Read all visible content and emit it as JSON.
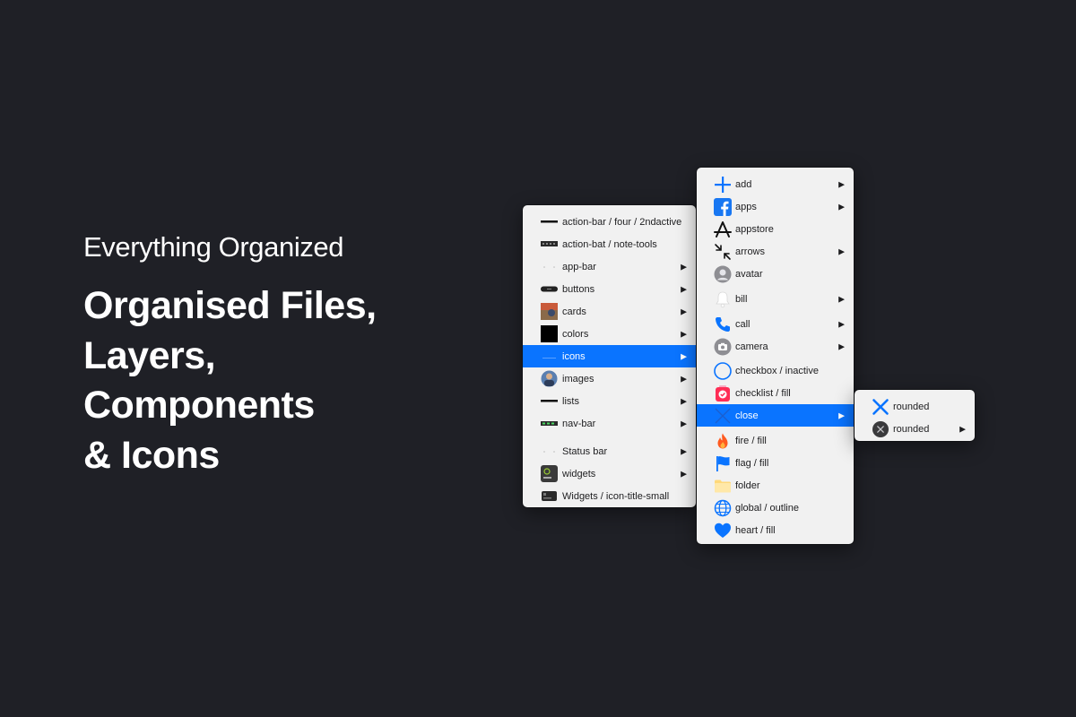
{
  "hero": {
    "eyebrow": "Everything Organized",
    "headline": [
      "Organised Files,",
      "Layers,",
      "Components",
      "& Icons"
    ]
  },
  "colors": {
    "background": "#1f2026",
    "menu_bg": "#f1f1f1",
    "selection": "#0a74ff",
    "icon_blue": "#0a74ff"
  },
  "menu_layers": {
    "items": [
      {
        "label": "action-bar / four / 2ndactive",
        "thumb": "line-thumb",
        "submenu": false
      },
      {
        "label": "action-bat / note-tools",
        "thumb": "toolbar-thumb",
        "submenu": false
      },
      {
        "label": "app-bar",
        "thumb": "dots-thumb",
        "submenu": true
      },
      {
        "label": "buttons",
        "thumb": "pill-button-thumb",
        "submenu": true
      },
      {
        "label": "cards",
        "thumb": "photo-card-thumb",
        "submenu": true
      },
      {
        "label": "colors",
        "thumb": "black-swatch-thumb",
        "submenu": true
      },
      {
        "label": "icons",
        "thumb": "icon-thumb",
        "submenu": true,
        "selected": true
      },
      {
        "label": "images",
        "thumb": "image-thumb",
        "submenu": true
      },
      {
        "label": "lists",
        "thumb": "line-thumb",
        "submenu": true
      },
      {
        "label": "nav-bar",
        "thumb": "navbar-thumb",
        "submenu": true
      },
      {
        "label": "Status bar",
        "thumb": "dots-thumb",
        "submenu": true
      },
      {
        "label": "widgets",
        "thumb": "widget-thumb",
        "submenu": true
      },
      {
        "label": "Widgets / icon-title-small",
        "thumb": "widget-small-thumb",
        "submenu": false
      }
    ],
    "arrow_glyph": "▶"
  },
  "menu_icons": {
    "items": [
      {
        "label": "add",
        "icon": "plus-icon",
        "submenu": true
      },
      {
        "label": "apps",
        "icon": "facebook-icon",
        "submenu": true
      },
      {
        "label": "appstore",
        "icon": "appstore-icon",
        "submenu": false
      },
      {
        "label": "arrows",
        "icon": "collapse-arrows-icon",
        "submenu": true
      },
      {
        "label": "avatar",
        "icon": "avatar-icon",
        "submenu": false
      },
      {
        "label": "bill",
        "icon": "bell-icon",
        "submenu": true
      },
      {
        "label": "call",
        "icon": "phone-icon",
        "submenu": true
      },
      {
        "label": "camera",
        "icon": "camera-icon",
        "submenu": true
      },
      {
        "label": "checkbox / inactive",
        "icon": "circle-outline-icon",
        "submenu": false
      },
      {
        "label": "checklist / fill",
        "icon": "checklist-icon",
        "submenu": false
      },
      {
        "label": "close",
        "icon": "close-icon",
        "submenu": true,
        "selected": true
      },
      {
        "label": "fire / fill",
        "icon": "fire-icon",
        "submenu": false
      },
      {
        "label": "flag / fill",
        "icon": "flag-icon",
        "submenu": false
      },
      {
        "label": "folder",
        "icon": "folder-icon",
        "submenu": false
      },
      {
        "label": "global / outline",
        "icon": "globe-icon",
        "submenu": false
      },
      {
        "label": "heart / fill",
        "icon": "heart-icon",
        "submenu": false
      }
    ]
  },
  "menu_close": {
    "items": [
      {
        "label": "rounded",
        "icon": "close-icon",
        "submenu": false
      },
      {
        "label": "rounded",
        "icon": "close-circle-icon",
        "submenu": true
      }
    ]
  }
}
